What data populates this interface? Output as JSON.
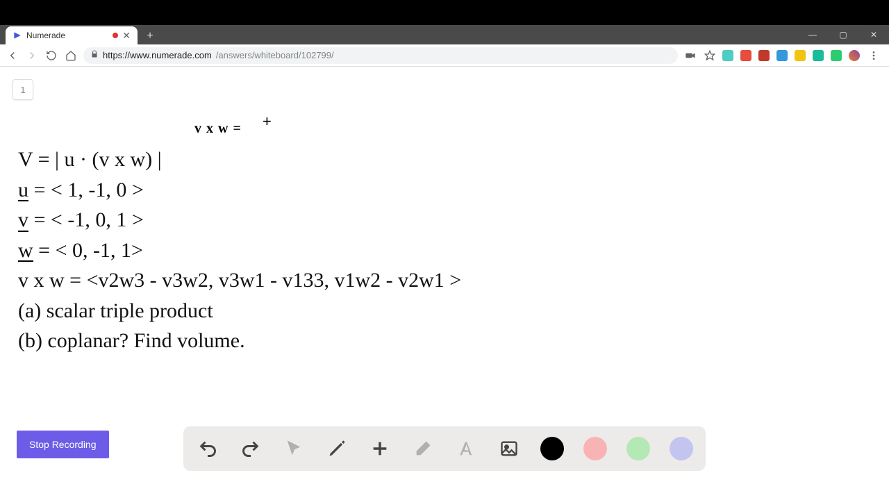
{
  "browser": {
    "tab_title": "Numerade",
    "tab_recording_indicator": true,
    "url_host": "https://www.numerade.com",
    "url_path": "/answers/whiteboard/102799/",
    "win_min": "—",
    "win_max": "▢",
    "win_close": "✕",
    "newtab": "+",
    "tab_x": "✕"
  },
  "page": {
    "step_number": "1",
    "handwriting": "v x w =",
    "cursor_symbol": "+",
    "math_lines": {
      "l1": "V = | u · (v x w) |",
      "l2_u": "u",
      "l2_rest": " = < 1, -1, 0 >",
      "l3_v": "v",
      "l3_rest": " = < -1, 0, 1 >",
      "l4_w": "w",
      "l4_rest": " = < 0, -1, 1>",
      "l5": "v x w = <v2w3 - v3w2, v3w1 - v133, v1w2 - v2w1 >",
      "l6": "(a) scalar triple product",
      "l7": "(b) coplanar? Find volume."
    },
    "stop_button": "Stop Recording",
    "toolbar": {
      "undo": "undo",
      "redo": "redo",
      "pointer": "pointer",
      "pen": "pen",
      "plus": "plus",
      "eraser": "eraser",
      "text": "text",
      "image": "image",
      "color_black": "#000000",
      "color_red": "#f8b4b4",
      "color_green": "#b4e8b4",
      "color_blue": "#c4c4f0"
    }
  }
}
